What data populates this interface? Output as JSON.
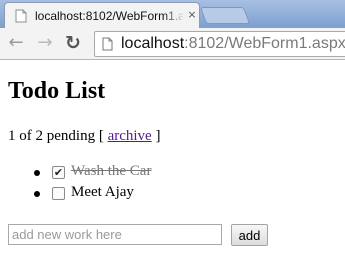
{
  "browser": {
    "tab_title": "localhost:8102/WebForm1.aspx",
    "tab_close_glyph": "×",
    "favicon": "page-icon",
    "url_host": "localhost",
    "url_rest": ":8102/WebForm1.aspx",
    "nav": {
      "back_glyph": "←",
      "forward_glyph": "→",
      "reload_glyph": "↻"
    }
  },
  "page": {
    "title": "Todo List",
    "status_text": "1 of 2 pending [ ",
    "archive_label": "archive",
    "status_suffix": " ]",
    "todos": [
      {
        "text": "Wash the Car",
        "done": true
      },
      {
        "text": "Meet Ajay",
        "done": false
      }
    ],
    "new_item_placeholder": "add new work here",
    "add_label": "add"
  },
  "colors": {
    "tabstrip": "#8eaed6",
    "link": "#551a8b",
    "done_text": "#777777"
  }
}
